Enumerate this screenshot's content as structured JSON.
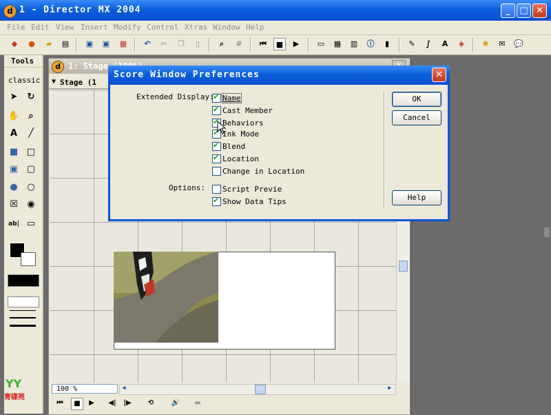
{
  "app": {
    "title": "1 - Director MX 2004",
    "icon_letter": "d"
  },
  "menu": [
    "File",
    "Edit",
    "View",
    "Insert",
    "Modify",
    "Control",
    "Xtras",
    "Window",
    "Help"
  ],
  "tools_panel": {
    "header": "Tools",
    "mode": "classic"
  },
  "stage_window": {
    "title": "1: Stage (100%)",
    "bar_label": "Stage (1",
    "zoom": "100 %"
  },
  "dialog": {
    "title": "Score Window Preferences",
    "extended_display_label": "Extended Display:",
    "options_label": "Options:",
    "extended": [
      {
        "label": "Name",
        "checked": true
      },
      {
        "label": "Cast Member",
        "checked": true
      },
      {
        "label": "Behaviors",
        "checked": true
      },
      {
        "label": "Ink Mode",
        "checked": true
      },
      {
        "label": "Blend",
        "checked": true
      },
      {
        "label": "Location",
        "checked": true
      },
      {
        "label": "Change in Location",
        "checked": false
      }
    ],
    "options": [
      {
        "label": "Script Previe",
        "checked": false
      },
      {
        "label": "Show Data Tips",
        "checked": true
      }
    ],
    "ok_label": "OK",
    "cancel_label": "Cancel",
    "help_label": "Help"
  },
  "logo_text": "育碟苑",
  "colors": {
    "titlebar": "#0a5fdc",
    "checkmark": "#21a121",
    "panel": "#ece9d8"
  }
}
